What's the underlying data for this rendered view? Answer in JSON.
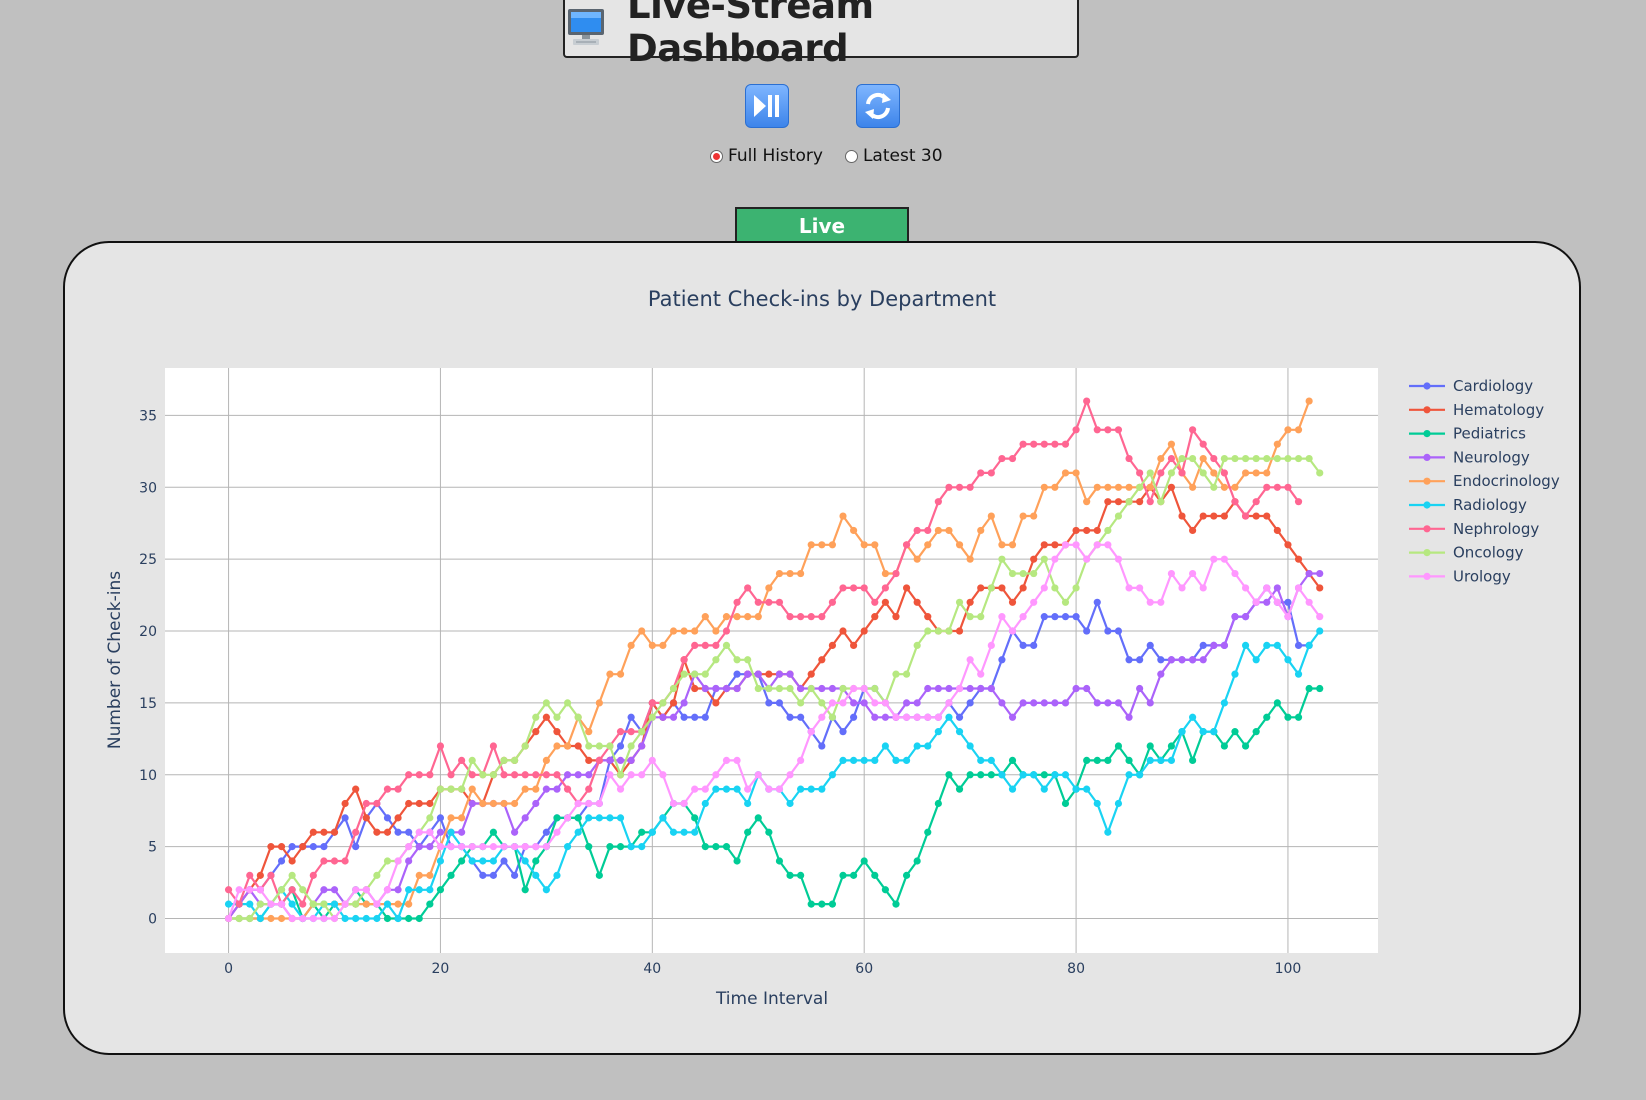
{
  "header": {
    "title": "Live-Stream Dashboard"
  },
  "controls": {
    "play_pause_icon": "play-pause-icon",
    "refresh_icon": "refresh-icon",
    "radio_full": "Full History",
    "radio_latest": "Latest 30",
    "selected": "Full History"
  },
  "tab": {
    "label": "Live"
  },
  "colors": {
    "background": "#c0c0c0",
    "panel": "#e5e5e5",
    "live_tab": "#3cb371"
  },
  "chart_data": {
    "type": "line",
    "title": "Patient Check-ins by Department",
    "xlabel": "Time Interval",
    "ylabel": "Number of Check-ins",
    "xlim": [
      -6,
      108.5
    ],
    "ylim": [
      -2.4,
      38.3
    ],
    "xticks": [
      0,
      20,
      40,
      60,
      80,
      100
    ],
    "yticks": [
      0,
      5,
      10,
      15,
      20,
      25,
      30,
      35
    ],
    "grid": true,
    "legend": "right",
    "x_start": 0,
    "series": [
      {
        "name": "Cardiology",
        "color": "#636efa",
        "values": [
          0,
          1,
          2,
          2,
          3,
          4,
          5,
          5,
          5,
          5,
          6,
          7,
          5,
          7,
          8,
          7,
          6,
          6,
          5,
          6,
          7,
          5,
          5,
          4,
          3,
          3,
          4,
          3,
          5,
          5,
          6,
          7,
          7,
          7,
          8,
          8,
          11,
          12,
          14,
          13,
          15,
          14,
          15,
          14,
          14,
          14,
          16,
          16,
          17,
          17,
          17,
          15,
          15,
          14,
          14,
          13,
          12,
          14,
          13,
          14,
          16,
          16,
          15,
          14,
          14,
          14,
          14,
          14,
          15,
          14,
          15,
          16,
          16,
          18,
          20,
          19,
          19,
          21,
          21,
          21,
          21,
          20,
          22,
          20,
          20,
          18,
          18,
          19,
          18,
          18,
          18,
          18,
          19,
          19,
          19,
          21,
          21,
          22,
          23,
          22,
          22,
          19,
          19
        ]
      },
      {
        "name": "Hematology",
        "color": "#ef553b",
        "values": [
          0,
          1,
          2,
          3,
          5,
          5,
          4,
          5,
          6,
          6,
          6,
          8,
          9,
          7,
          6,
          6,
          7,
          8,
          8,
          8,
          9,
          9,
          9,
          8,
          8,
          10,
          11,
          11,
          12,
          13,
          14,
          13,
          12,
          12,
          11,
          11,
          11,
          10,
          11,
          12,
          15,
          14,
          15,
          18,
          16,
          16,
          15,
          16,
          16,
          17,
          17,
          17,
          17,
          17,
          16,
          17,
          18,
          19,
          20,
          19,
          20,
          21,
          22,
          21,
          23,
          22,
          21,
          20,
          20,
          20,
          22,
          23,
          23,
          23,
          22,
          23,
          25,
          26,
          26,
          26,
          27,
          27,
          27,
          29,
          29,
          29,
          29,
          30,
          29,
          30,
          28,
          27,
          28,
          28,
          28,
          29,
          28,
          28,
          28,
          27,
          26,
          25,
          24,
          23
        ]
      },
      {
        "name": "Pediatrics",
        "color": "#00cc96",
        "values": [
          0,
          0,
          0,
          0,
          1,
          1,
          2,
          0,
          1,
          0,
          1,
          1,
          2,
          1,
          1,
          0,
          0,
          0,
          0,
          1,
          2,
          3,
          4,
          5,
          5,
          6,
          5,
          5,
          2,
          4,
          5,
          7,
          7,
          7,
          5,
          3,
          5,
          5,
          5,
          6,
          6,
          7,
          8,
          8,
          7,
          5,
          5,
          5,
          4,
          6,
          7,
          6,
          4,
          3,
          3,
          1,
          1,
          1,
          3,
          3,
          4,
          3,
          2,
          1,
          3,
          4,
          6,
          8,
          10,
          9,
          10,
          10,
          10,
          10,
          11,
          10,
          10,
          10,
          10,
          8,
          9,
          11,
          11,
          11,
          12,
          11,
          10,
          12,
          11,
          12,
          13,
          11,
          13,
          13,
          12,
          13,
          12,
          13,
          14,
          15,
          14,
          14,
          16,
          16
        ]
      },
      {
        "name": "Neurology",
        "color": "#ab63fa",
        "values": [
          0,
          1,
          2,
          1,
          1,
          1,
          0,
          0,
          1,
          2,
          2,
          1,
          1,
          2,
          1,
          2,
          2,
          4,
          5,
          5,
          6,
          6,
          6,
          8,
          8,
          8,
          8,
          6,
          7,
          8,
          9,
          9,
          10,
          10,
          10,
          11,
          11,
          11,
          11,
          12,
          14,
          14,
          14,
          15,
          17,
          16,
          16,
          16,
          16,
          17,
          17,
          16,
          17,
          17,
          16,
          16,
          16,
          16,
          16,
          15,
          15,
          14,
          14,
          14,
          15,
          15,
          16,
          16,
          16,
          16,
          16,
          16,
          16,
          15,
          14,
          15,
          15,
          15,
          15,
          15,
          16,
          16,
          15,
          15,
          15,
          14,
          16,
          15,
          17,
          18,
          18,
          18,
          18,
          19,
          19,
          21,
          21,
          22,
          22,
          23,
          21,
          23,
          24,
          24
        ]
      },
      {
        "name": "Endocrinology",
        "color": "#ffa15a",
        "values": [
          0,
          0,
          0,
          0,
          0,
          0,
          0,
          0,
          1,
          1,
          1,
          1,
          1,
          1,
          1,
          1,
          1,
          1,
          3,
          3,
          5,
          7,
          7,
          9,
          8,
          8,
          8,
          8,
          9,
          9,
          11,
          12,
          12,
          14,
          13,
          15,
          17,
          17,
          19,
          20,
          19,
          19,
          20,
          20,
          20,
          21,
          20,
          21,
          21,
          21,
          21,
          23,
          24,
          24,
          24,
          26,
          26,
          26,
          28,
          27,
          26,
          26,
          24,
          24,
          26,
          25,
          26,
          27,
          27,
          26,
          25,
          27,
          28,
          26,
          26,
          28,
          28,
          30,
          30,
          31,
          31,
          29,
          30,
          30,
          30,
          30,
          30,
          30,
          32,
          33,
          31,
          30,
          32,
          31,
          30,
          30,
          31,
          31,
          31,
          33,
          34,
          34,
          36
        ]
      },
      {
        "name": "Radiology",
        "color": "#19d3f3",
        "values": [
          1,
          1,
          1,
          0,
          1,
          2,
          1,
          0,
          0,
          1,
          1,
          0,
          0,
          0,
          0,
          1,
          0,
          2,
          2,
          2,
          4,
          6,
          5,
          4,
          4,
          4,
          5,
          5,
          4,
          3,
          2,
          3,
          5,
          6,
          7,
          7,
          7,
          7,
          5,
          5,
          6,
          7,
          6,
          6,
          6,
          8,
          9,
          9,
          9,
          8,
          10,
          9,
          9,
          8,
          9,
          9,
          9,
          10,
          11,
          11,
          11,
          11,
          12,
          11,
          11,
          12,
          12,
          13,
          14,
          13,
          12,
          11,
          11,
          10,
          9,
          10,
          10,
          9,
          10,
          10,
          9,
          9,
          8,
          6,
          8,
          10,
          10,
          11,
          11,
          11,
          13,
          14,
          13,
          13,
          15,
          17,
          19,
          18,
          19,
          19,
          18,
          17,
          19,
          20
        ]
      },
      {
        "name": "Nephrology",
        "color": "#ff6692",
        "values": [
          2,
          1,
          3,
          2,
          3,
          1,
          2,
          1,
          3,
          4,
          4,
          4,
          6,
          8,
          8,
          9,
          9,
          10,
          10,
          10,
          12,
          10,
          11,
          10,
          10,
          12,
          10,
          10,
          10,
          10,
          10,
          10,
          9,
          8,
          9,
          11,
          12,
          13,
          13,
          13,
          15,
          15,
          16,
          18,
          19,
          19,
          19,
          20,
          22,
          23,
          22,
          22,
          22,
          21,
          21,
          21,
          21,
          22,
          23,
          23,
          23,
          22,
          23,
          24,
          26,
          27,
          27,
          29,
          30,
          30,
          30,
          31,
          31,
          32,
          32,
          33,
          33,
          33,
          33,
          33,
          34,
          36,
          34,
          34,
          34,
          32,
          31,
          29,
          31,
          32,
          31,
          34,
          33,
          32,
          31,
          29,
          28,
          29,
          30,
          30,
          30,
          29
        ]
      },
      {
        "name": "Oncology",
        "color": "#b6e880",
        "values": [
          0,
          0,
          0,
          1,
          1,
          2,
          3,
          2,
          1,
          1,
          0,
          1,
          1,
          2,
          3,
          4,
          4,
          5,
          6,
          7,
          9,
          9,
          9,
          11,
          10,
          10,
          11,
          11,
          12,
          14,
          15,
          14,
          15,
          14,
          12,
          12,
          12,
          10,
          12,
          13,
          14,
          15,
          16,
          17,
          17,
          17,
          18,
          19,
          18,
          18,
          16,
          16,
          16,
          16,
          15,
          16,
          15,
          14,
          16,
          16,
          16,
          16,
          15,
          17,
          17,
          19,
          20,
          20,
          20,
          22,
          21,
          21,
          23,
          25,
          24,
          24,
          24,
          25,
          23,
          22,
          23,
          25,
          26,
          27,
          28,
          29,
          30,
          31,
          29,
          31,
          32,
          32,
          31,
          30,
          32,
          32,
          32,
          32,
          32,
          32,
          32,
          32,
          32,
          31
        ]
      },
      {
        "name": "Urology",
        "color": "#ff97ff",
        "values": [
          0,
          2,
          2,
          2,
          1,
          1,
          0,
          0,
          0,
          0,
          0,
          1,
          2,
          2,
          1,
          2,
          4,
          5,
          6,
          6,
          5,
          5,
          5,
          5,
          5,
          5,
          5,
          5,
          5,
          5,
          5,
          6,
          7,
          8,
          8,
          8,
          10,
          9,
          10,
          10,
          11,
          10,
          8,
          8,
          9,
          9,
          10,
          11,
          11,
          9,
          10,
          9,
          9,
          10,
          11,
          13,
          14,
          15,
          15,
          16,
          16,
          15,
          15,
          14,
          14,
          14,
          14,
          14,
          15,
          16,
          18,
          17,
          19,
          21,
          20,
          21,
          22,
          23,
          25,
          26,
          26,
          25,
          26,
          26,
          25,
          23,
          23,
          22,
          22,
          24,
          23,
          24,
          23,
          25,
          25,
          24,
          23,
          22,
          23,
          22,
          21,
          23,
          22,
          21
        ]
      }
    ]
  }
}
